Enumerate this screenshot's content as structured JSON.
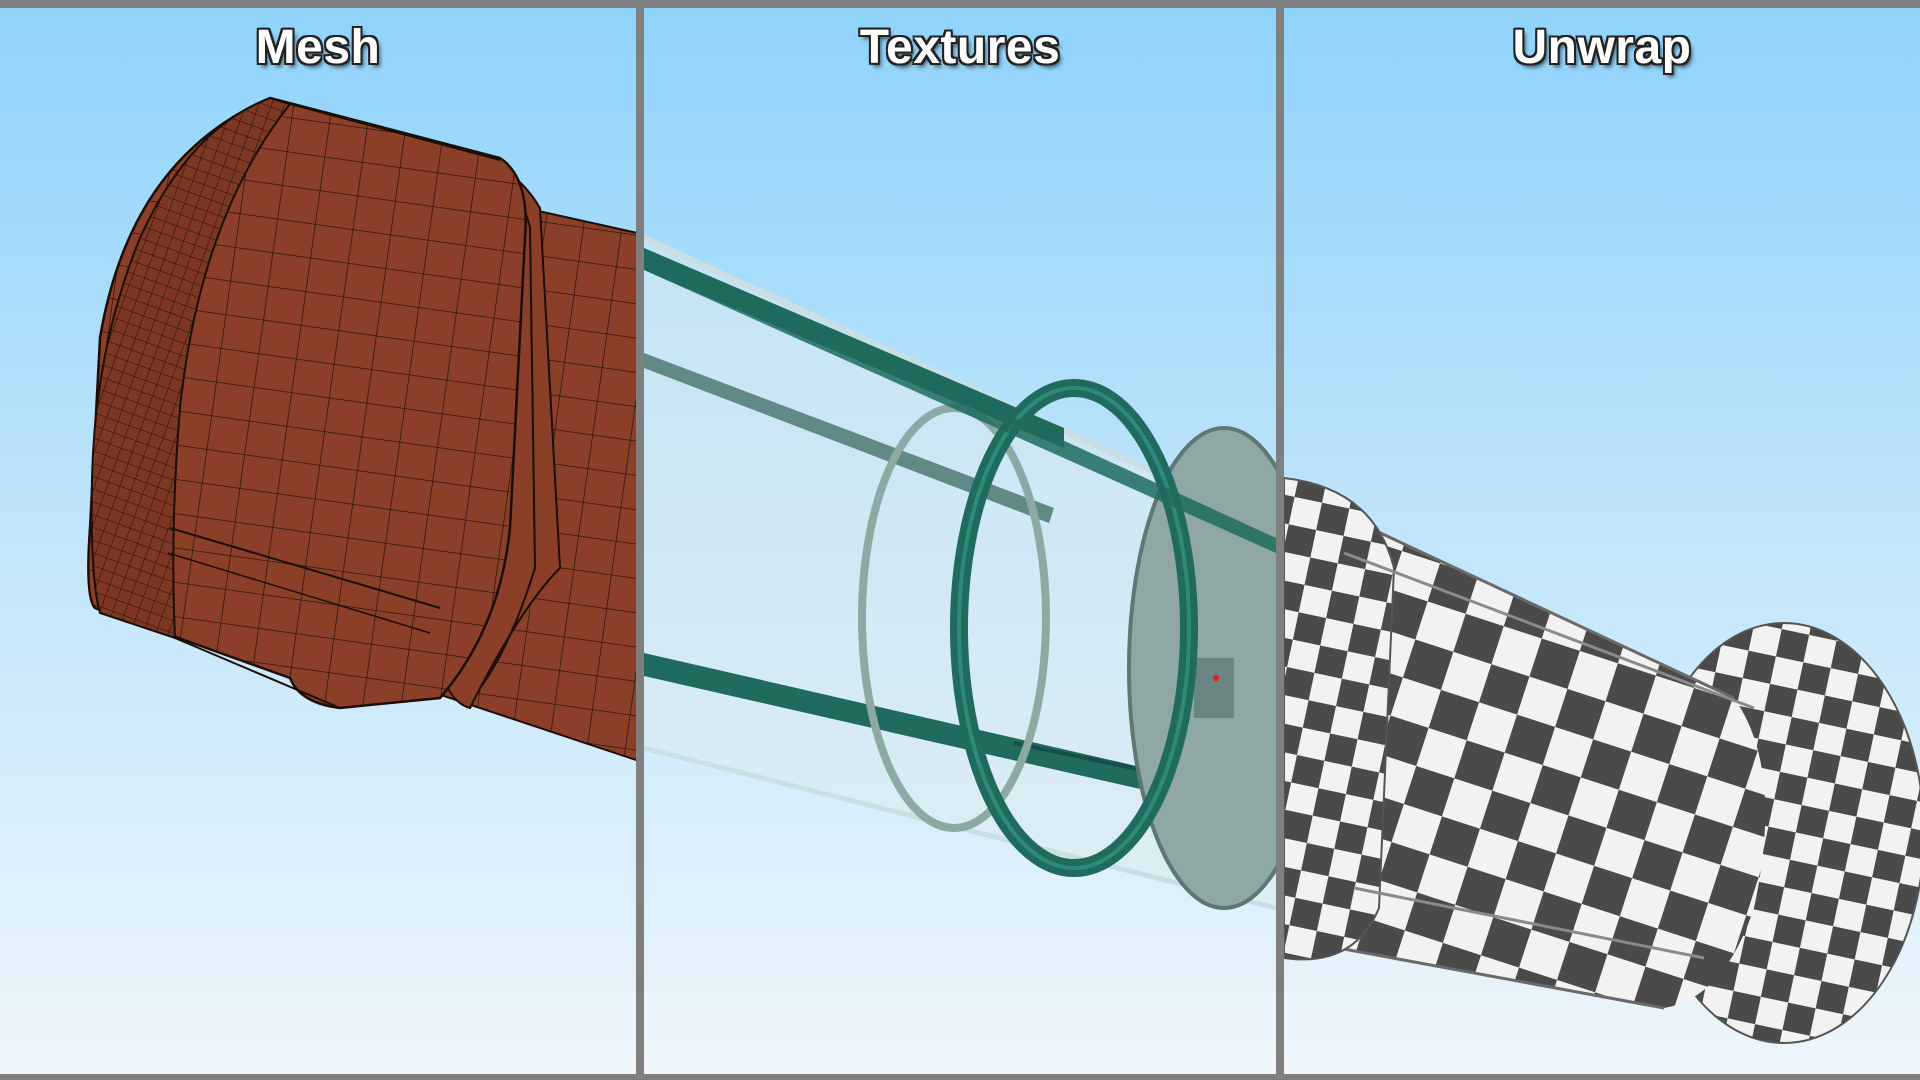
{
  "panels": {
    "mesh": {
      "title": "Mesh",
      "fill_color": "#8b3f28",
      "wire_color": "#1c0e08"
    },
    "textures": {
      "title": "Textures",
      "frame_color": "#1f6b5e",
      "glass_color": "#dcebee"
    },
    "unwrap": {
      "title": "Unwrap",
      "check_dark": "#4a4a4a",
      "check_light": "#f2f2f2"
    }
  },
  "colors": {
    "divider": "#7f7f7f",
    "sky_top": "#8fd3fb",
    "sky_bottom": "#eef6fb"
  }
}
